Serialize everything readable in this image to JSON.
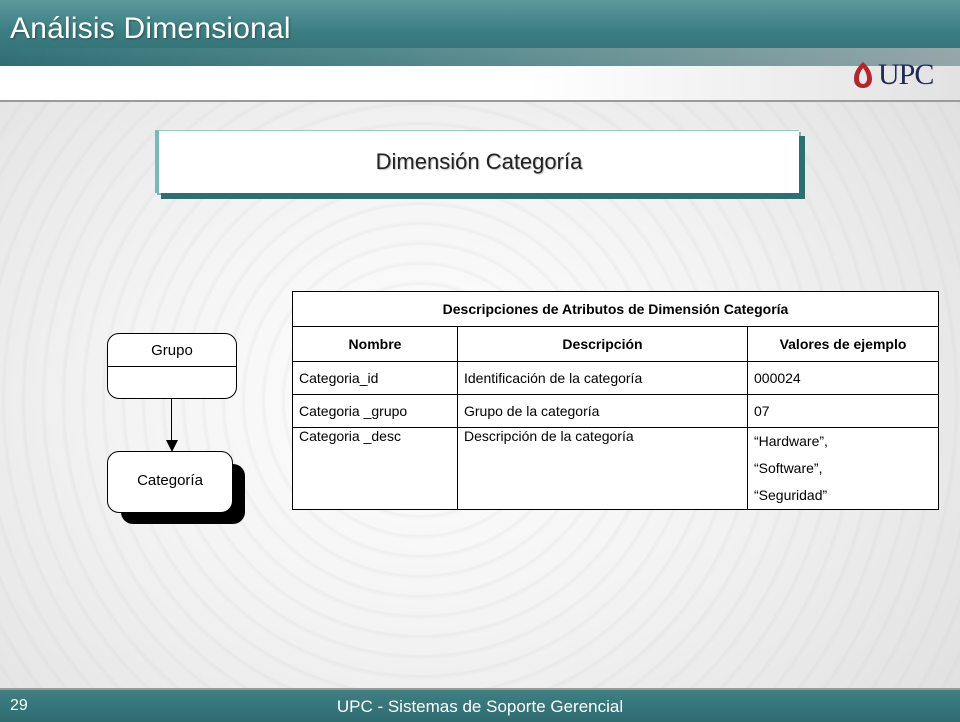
{
  "header": {
    "title": "Análisis Dimensional"
  },
  "logo": {
    "text": "UPC"
  },
  "subtitle": "Dimensión Categoría",
  "diagram": {
    "parent_entity": "Grupo",
    "child_entity": "Categoría"
  },
  "table": {
    "caption": "Descripciones de Atributos de Dimensión Categoría",
    "columns": [
      "Nombre",
      "Descripción",
      "Valores de ejemplo"
    ],
    "rows": [
      {
        "nombre": "Categoria_id",
        "descripcion": "Identificación de la categoría",
        "valores": [
          "000024"
        ]
      },
      {
        "nombre": "Categoria _grupo",
        "descripcion": "Grupo de la categoría",
        "valores": [
          "07"
        ]
      },
      {
        "nombre": "Categoria _desc",
        "descripcion": "Descripción de la categoría",
        "valores": [
          "“Hardware”,",
          "“Software”,",
          "“Seguridad”"
        ]
      }
    ]
  },
  "footer": {
    "page_number": "29",
    "text": "UPC - Sistemas de Soporte Gerencial"
  },
  "colors": {
    "brand_teal": "#3e7f83",
    "logo_red": "#b3262e",
    "logo_navy": "#1e2a57"
  }
}
